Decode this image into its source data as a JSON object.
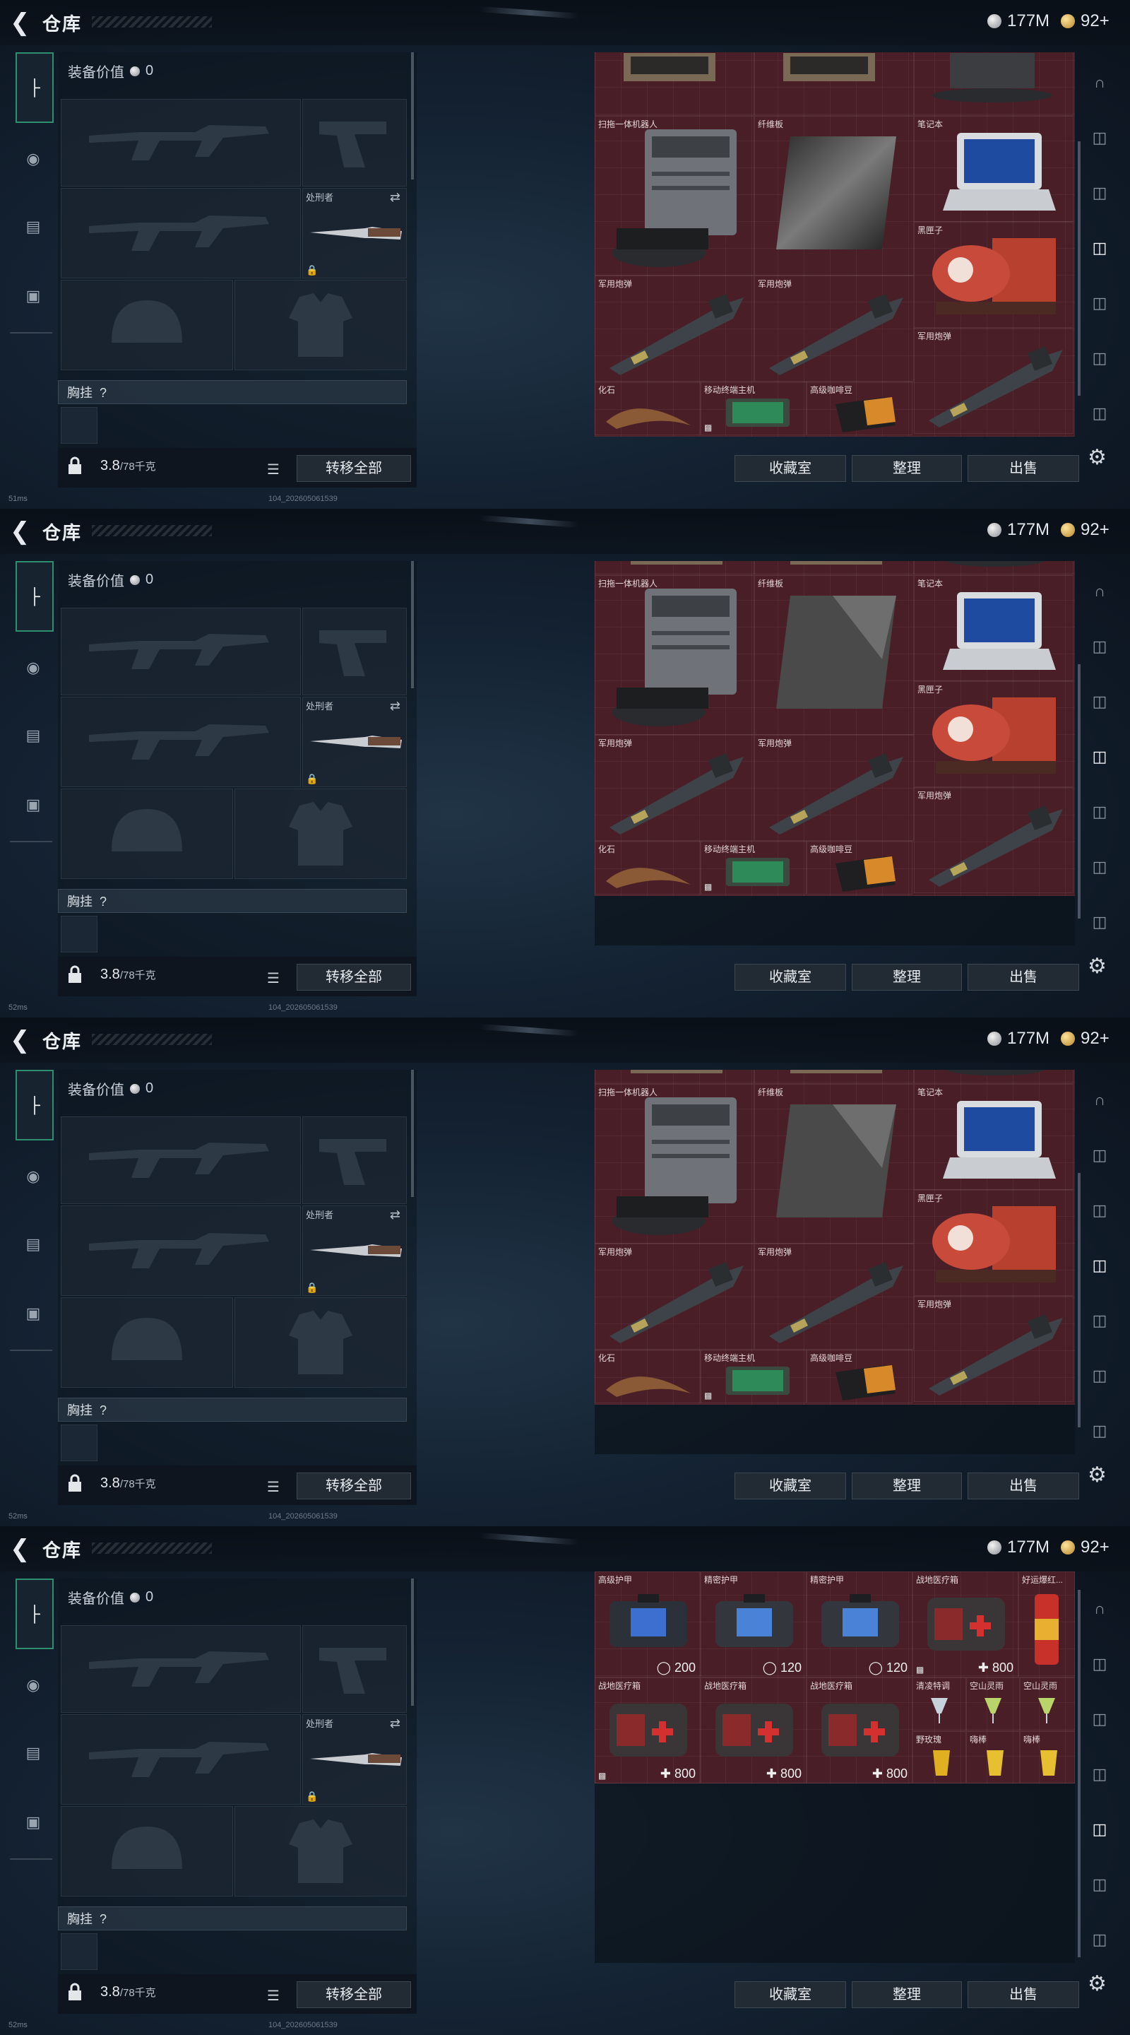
{
  "header": {
    "title": "仓库",
    "silver": "177M",
    "gold": "92+"
  },
  "loadout": {
    "eq_value_label": "装备价值",
    "eq_value": "0",
    "melee_label": "处刑者",
    "chest_label": "胸挂",
    "chest_hint": "?",
    "weight": "3.8",
    "weight_max": "/78千克",
    "transfer_all": "转移全部"
  },
  "footer": {
    "collection": "收藏室",
    "organize": "整理",
    "sell": "出售"
  },
  "frames": [
    {
      "ping": "51ms",
      "build": "104_202605061539"
    },
    {
      "ping": "52ms",
      "build": "104_202605061539"
    },
    {
      "ping": "52ms",
      "build": "104_202605061539"
    },
    {
      "ping": "52ms",
      "build": "104_202605061539"
    }
  ],
  "stash_items": {
    "robot": "扫拖一体机器人",
    "fiber": "纤维板",
    "laptop": "笔记本",
    "blackbox": "黑匣子",
    "shell1": "军用炮弹",
    "shell2": "军用炮弹",
    "shell3": "军用炮弹",
    "fossil": "化石",
    "terminal": "移动终端主机",
    "coffee": "高级咖啡豆"
  },
  "stash2": {
    "armor1": "高级护甲",
    "armor1_val": "200",
    "armor2": "精密护甲",
    "armor2_val": "120",
    "armor3": "精密护甲",
    "armor3_val": "120",
    "med1": "战地医疗箱",
    "med1_val": "800",
    "med2": "战地医疗箱",
    "med2_val": "800",
    "med3": "战地医疗箱",
    "med3_val": "800",
    "med4": "战地医疗箱",
    "med4_val": "800",
    "drink_red": "好运爆红...",
    "drink1": "清凌特调",
    "drink2": "空山灵雨",
    "drink3": "空山灵雨",
    "drink4": "野玫瑰",
    "drink5": "嗨棒",
    "drink6": "嗨棒"
  },
  "colors": {
    "grid_bg": "#4a1e26",
    "accent_green": "#2e8f70"
  }
}
